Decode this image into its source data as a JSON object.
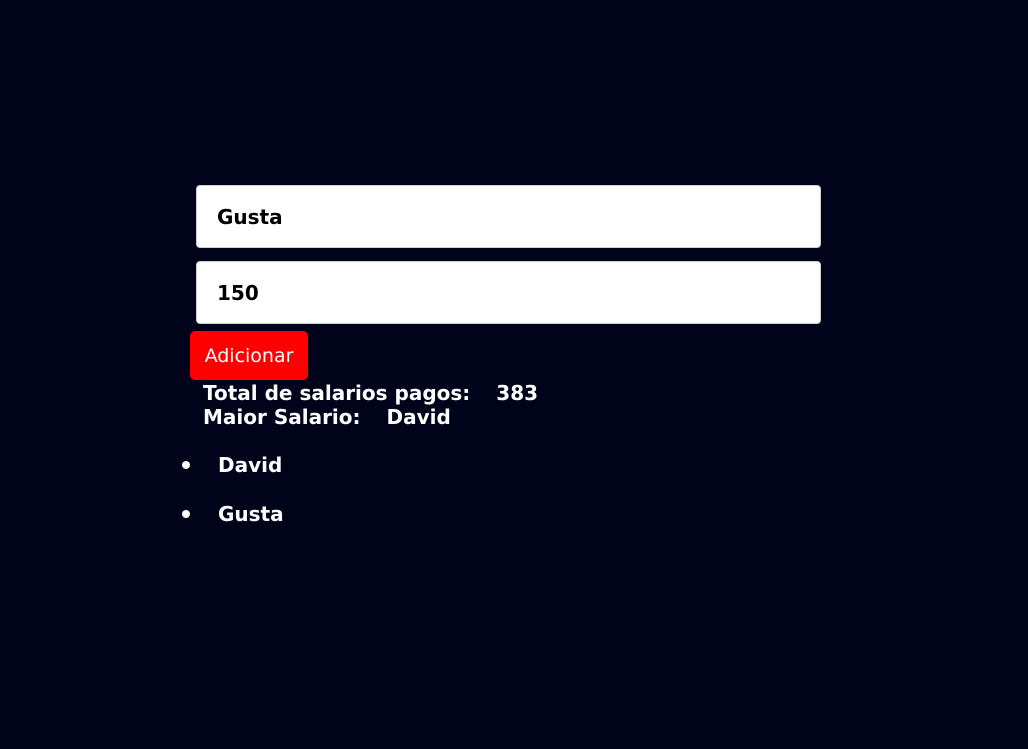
{
  "form": {
    "name_value": "Gusta",
    "salary_value": "150",
    "add_label": "Adicionar"
  },
  "summary": {
    "total_label": "Total de salarios pagos:",
    "total_value": "383",
    "max_label": "Maior Salario:",
    "max_value": "David"
  },
  "employees": [
    {
      "name": "David"
    },
    {
      "name": "Gusta"
    }
  ],
  "colors": {
    "background": "#00031a",
    "button": "#ff0000",
    "text": "#ffffff"
  }
}
